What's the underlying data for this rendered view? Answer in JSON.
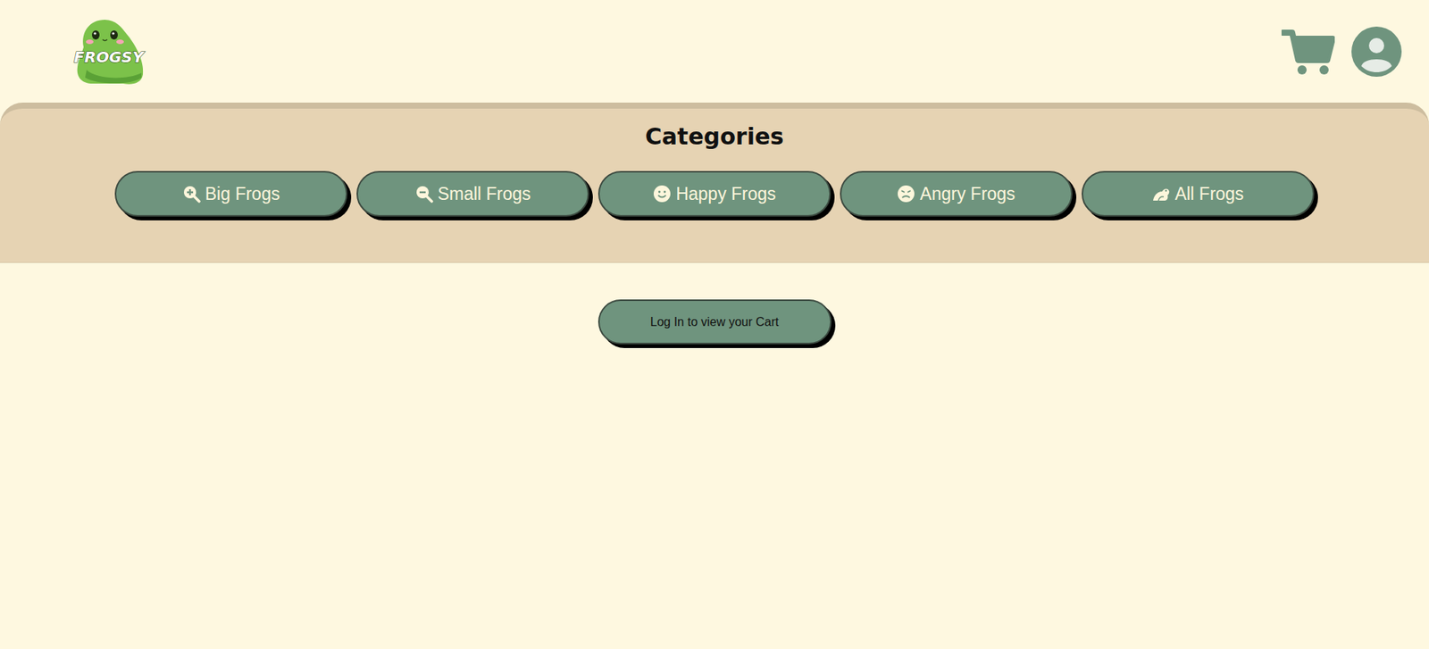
{
  "logo": {
    "text": "FROGSY"
  },
  "categories": {
    "title": "Categories",
    "items": [
      {
        "label": "Big Frogs"
      },
      {
        "label": "Small Frogs"
      },
      {
        "label": "Happy Frogs"
      },
      {
        "label": "Angry Frogs"
      },
      {
        "label": "All Frogs"
      }
    ]
  },
  "cart": {
    "message": "Log In to view your Cart"
  }
}
